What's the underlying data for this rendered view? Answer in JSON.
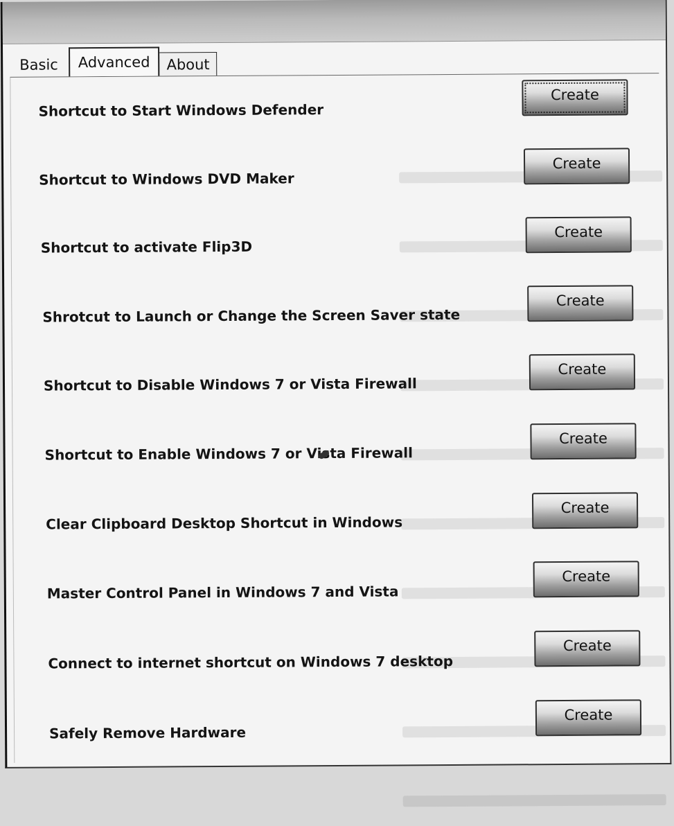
{
  "tabs": [
    {
      "label": "Basic",
      "active": false
    },
    {
      "label": "Advanced",
      "active": true
    },
    {
      "label": "About",
      "active": false
    }
  ],
  "rows": [
    {
      "label": "Shortcut to Start Windows Defender",
      "button": "Create"
    },
    {
      "label": "Shortcut to Windows DVD Maker",
      "button": "Create"
    },
    {
      "label": "Shortcut to activate Flip3D",
      "button": "Create"
    },
    {
      "label": "Shrotcut to Launch or Change the Screen Saver state",
      "button": "Create"
    },
    {
      "label": "Shortcut to Disable Windows 7 or Vista Firewall",
      "button": "Create"
    },
    {
      "label": "Shortcut to Enable Windows 7 or Vista Firewall",
      "button": "Create"
    },
    {
      "label": "Clear Clipboard Desktop Shortcut in Windows",
      "button": "Create"
    },
    {
      "label": "Master Control Panel in Windows 7 and Vista",
      "button": "Create"
    },
    {
      "label": "Connect to internet shortcut on Windows 7 desktop",
      "button": "Create"
    },
    {
      "label": "Safely Remove Hardware",
      "button": "Create"
    }
  ]
}
